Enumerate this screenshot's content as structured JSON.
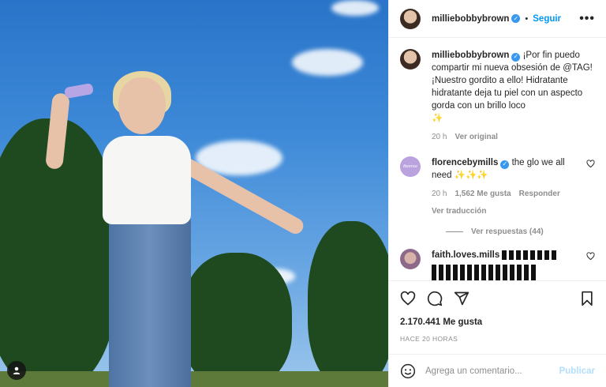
{
  "post": {
    "username": "milliebobbybrown",
    "follow_label": "Seguir",
    "dot": "•",
    "more_label": "•••"
  },
  "caption": {
    "username": "milliebobbybrown",
    "text": "¡Por fin puedo compartir mi nueva obsesión de @TAG! ¡Nuestro gordito a ello! Hidratante hidratante deja tu piel con un aspecto gorda con un brillo loco",
    "emoji": "✨",
    "time": "20 h",
    "see_original": "Ver original"
  },
  "comments": [
    {
      "username": "florencebymills",
      "avatar_text": "florence",
      "text": "the glo we all need",
      "emoji": "✨✨✨",
      "time": "20 h",
      "likes": "1,562 Me gusta",
      "reply": "Responder",
      "translate": "Ver traducción",
      "view_replies": "Ver respuestas (44)"
    },
    {
      "username": "faith.loves.mills"
    }
  ],
  "stats": {
    "likes": "2.170.441 Me gusta",
    "timestamp": "HACE 20 HORAS"
  },
  "composer": {
    "placeholder": "Agrega un comentario...",
    "publish_label": "Publicar"
  },
  "colors": {
    "link_blue": "#0095f6",
    "verified_blue": "#3897f0",
    "muted_gray": "#8e8e8e",
    "publish_disabled": "#b2dffc"
  },
  "icons": [
    "heart-icon",
    "comment-icon",
    "share-icon",
    "bookmark-icon",
    "emoji-icon",
    "user-tag-icon",
    "verified-icon"
  ]
}
